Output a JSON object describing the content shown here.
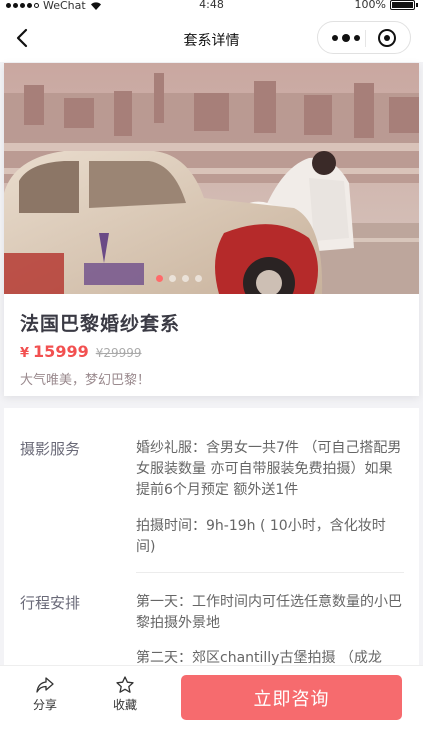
{
  "status_bar": {
    "carrier": "WeChat",
    "time": "4:48",
    "battery": "100%"
  },
  "navbar": {
    "title": "套系详情"
  },
  "product": {
    "title": "法国巴黎婚纱套系",
    "currency": "¥",
    "price": "15999",
    "original_price": "¥29999",
    "slogan": "大气唯美，梦幻巴黎！",
    "carousel": {
      "count": 4,
      "active_index": 0
    }
  },
  "details": [
    {
      "label": "摄影服务",
      "paragraphs": [
        "婚纱礼服：含男女一共7件 （可自己搭配男女服装数量 亦可自带服装免费拍摄）如果提前6个月预定 额外送1件",
        "拍摄时间：9h-19h ( 10小时，含化妆时间)"
      ]
    },
    {
      "label": "行程安排",
      "paragraphs": [
        "第一天：工作时间内可任选任意数量的小巴黎拍摄外景地",
        "第二天：郊区chantilly古堡拍摄 （成龙"
      ]
    }
  ],
  "footer": {
    "share": "分享",
    "favorite": "收藏",
    "cta": "立即咨询"
  }
}
